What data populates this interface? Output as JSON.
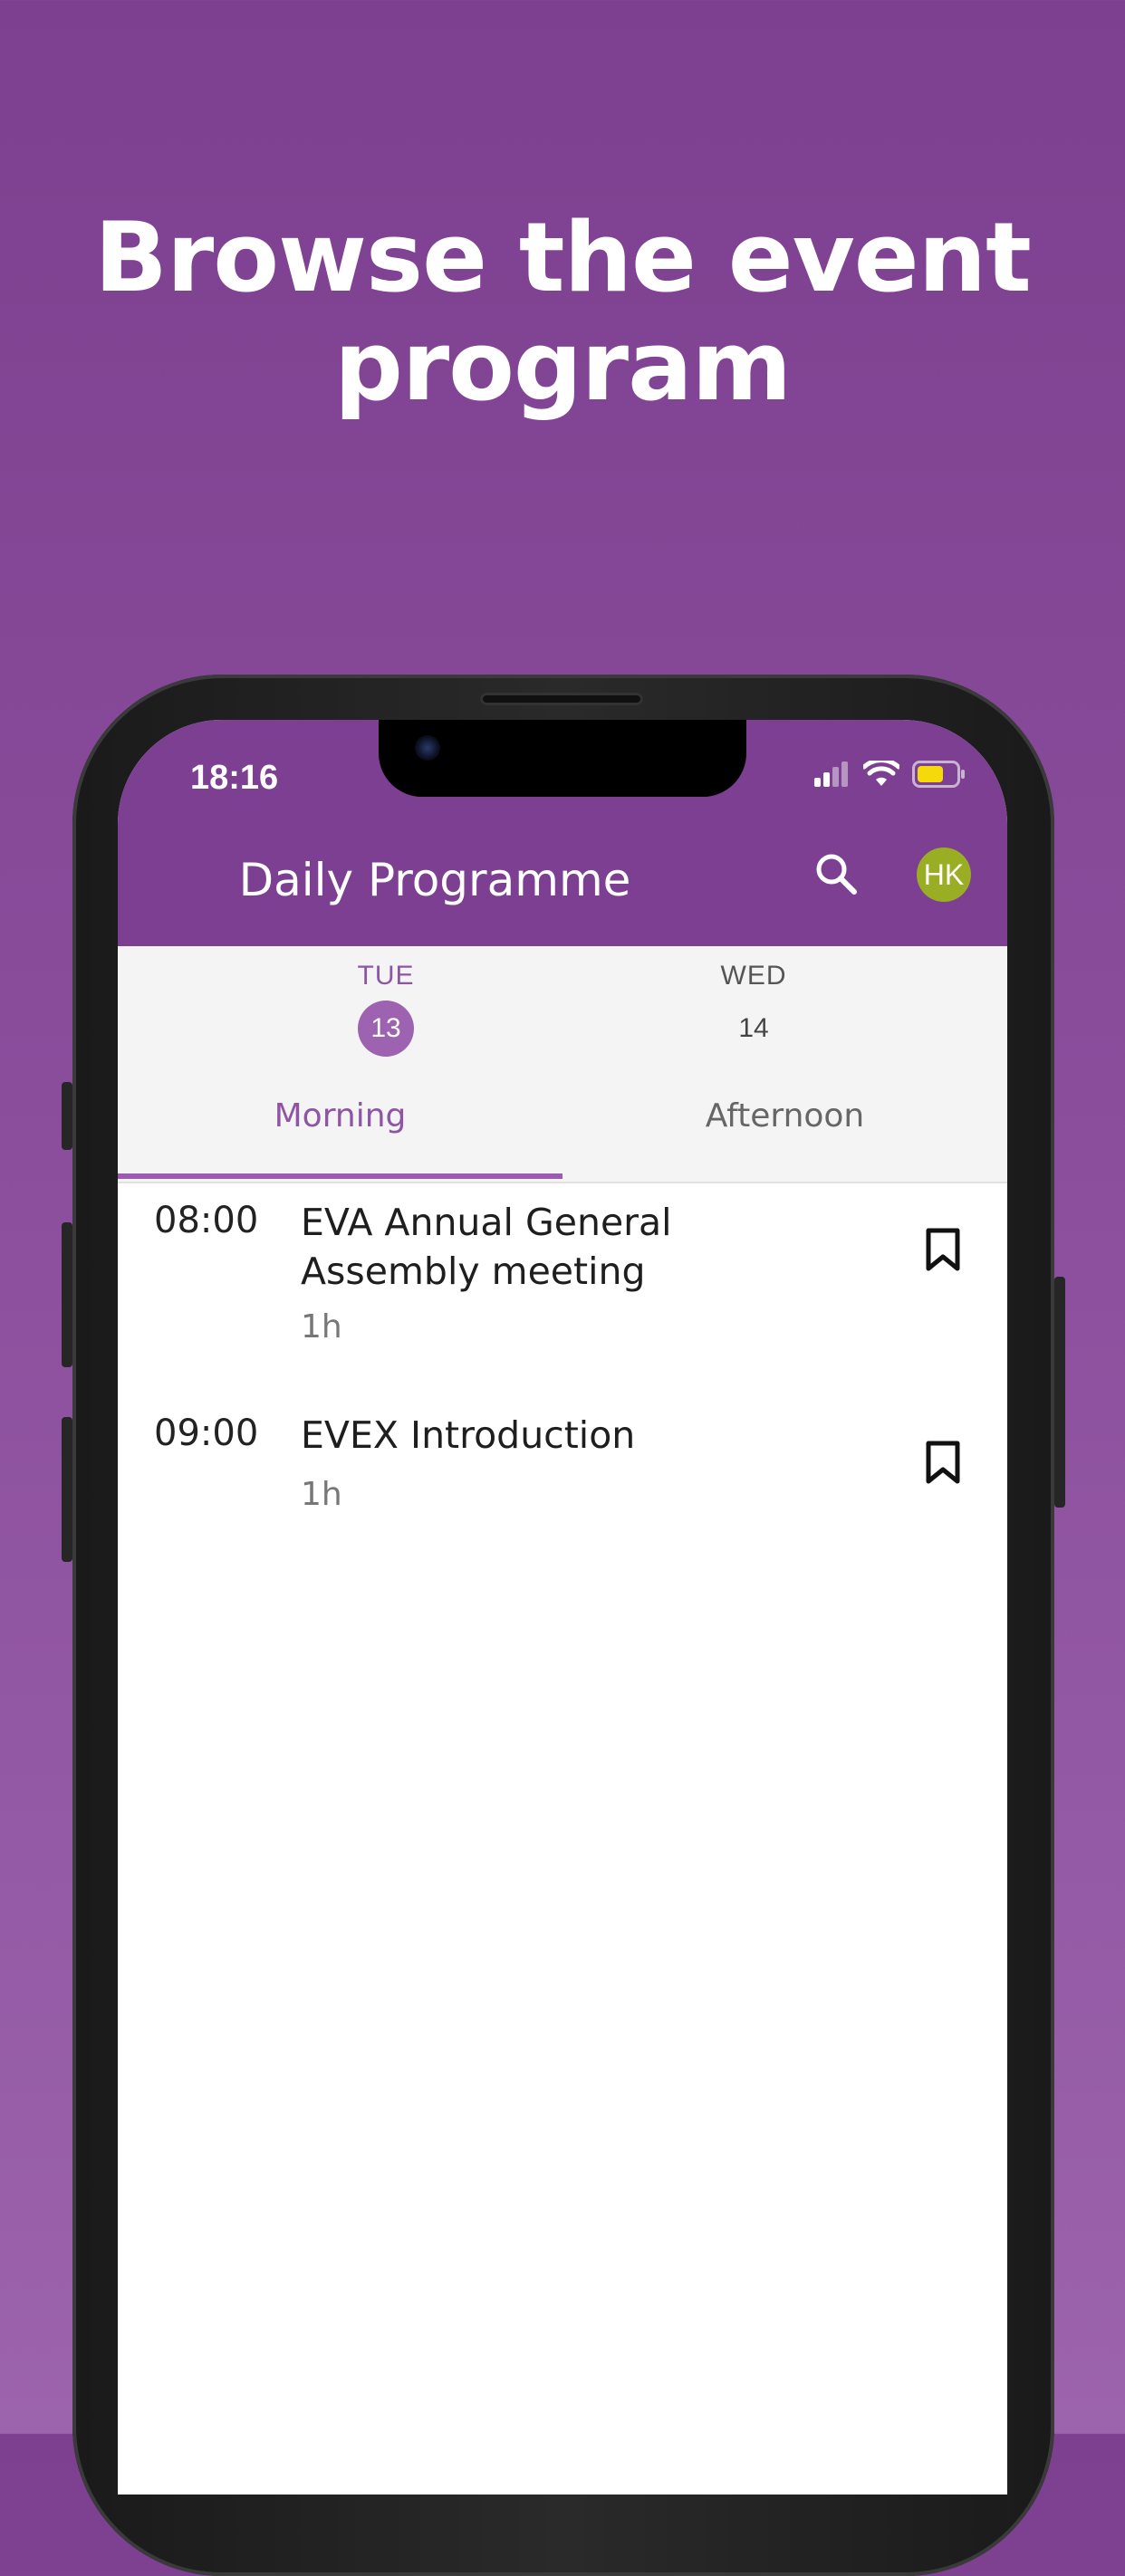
{
  "headline": {
    "line1": "Browse the event",
    "line2": "program"
  },
  "status_bar": {
    "time": "18:16"
  },
  "header": {
    "title": "Daily Programme",
    "avatar_initials": "HK"
  },
  "days": [
    {
      "name": "TUE",
      "number": "13",
      "selected": true
    },
    {
      "name": "WED",
      "number": "14",
      "selected": false
    }
  ],
  "tabs": [
    {
      "label": "Morning",
      "active": true
    },
    {
      "label": "Afternoon",
      "active": false
    }
  ],
  "sessions": [
    {
      "time": "08:00",
      "title": "EVA Annual General Assembly meeting",
      "duration": "1h"
    },
    {
      "time": "09:00",
      "title": "EVEX Introduction",
      "duration": "1h"
    }
  ],
  "colors": {
    "brand_purple": "#7c3f91",
    "accent_purple": "#9d62b0",
    "avatar_green": "#9aae24",
    "battery_yellow": "#f5d90a"
  },
  "icons": {
    "search": "search-icon",
    "bookmark": "bookmark-icon",
    "signal": "cellular-signal-icon",
    "wifi": "wifi-icon",
    "battery": "battery-icon"
  }
}
